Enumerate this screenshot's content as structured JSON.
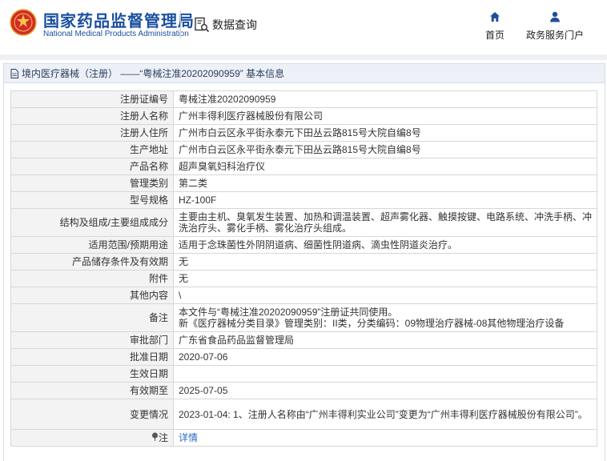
{
  "header": {
    "brand_cn": "国家药品监督管理局",
    "brand_en": "National Medical Products Administration",
    "query_label": "数据查询",
    "nav_home": "首页",
    "nav_gov": "政务服务门户"
  },
  "panel": {
    "title": "境内医疗器械（注册） ——“粤械注准20202090959” 基本信息"
  },
  "rows": [
    {
      "label": "注册证编号",
      "value": "粤械注准20202090959"
    },
    {
      "label": "注册人名称",
      "value": "广州丰得利医疗器械股份有限公司"
    },
    {
      "label": "注册人住所",
      "value": "广州市白云区永平街永泰元下田丛云路815号大院自编8号"
    },
    {
      "label": "生产地址",
      "value": "广州市白云区永平街永泰元下田丛云路815号大院自编8号"
    },
    {
      "label": "产品名称",
      "value": "超声臭氧妇科治疗仪"
    },
    {
      "label": "管理类别",
      "value": "第二类"
    },
    {
      "label": "型号规格",
      "value": "HZ-100F"
    },
    {
      "label": "结构及组成/主要组成成分",
      "value": "主要由主机、臭氧发生装置、加热和调温装置、超声雾化器、触摸按键、电路系统、冲洗手柄、冲洗治疗头、雾化手柄、雾化治疗头组成。"
    },
    {
      "label": "适用范围/预期用途",
      "value": "适用于念珠菌性外阴阴道病、细菌性阴道病、滴虫性阴道炎治疗。"
    },
    {
      "label": "产品储存条件及有效期",
      "value": "无"
    },
    {
      "label": "附件",
      "value": "无"
    },
    {
      "label": "其他内容",
      "value": "\\"
    },
    {
      "label": "备注",
      "value": "本文件与“粤械注准20202090959”注册证共同使用。\n新《医疗器械分类目录》管理类别：II类，分类编码：09物理治疗器械-08其他物理治疗设备"
    },
    {
      "label": "审批部门",
      "value": "广东省食品药品监督管理局"
    },
    {
      "label": "批准日期",
      "value": "2020-07-06"
    },
    {
      "label": "生效日期",
      "value": ""
    },
    {
      "label": "有效期至",
      "value": "2025-07-05"
    },
    {
      "label": "变更情况",
      "value": "2023-01-04: 1、注册人名称由“广州丰得利实业公司”变更为“广州丰得利医疗器械股份有限公司”。"
    },
    {
      "label": "注",
      "value": "详情"
    }
  ],
  "colors": {
    "brand": "#1a4fa0",
    "link": "#2b6cc4",
    "label_bg": "#f3f3f3",
    "title_bg": "#edf1f7"
  },
  "icons": {
    "logo": "national-emblem-icon",
    "query": "document-search-icon",
    "home": "home-icon",
    "user": "user-icon",
    "doc": "document-icon",
    "note": "pin-icon"
  }
}
